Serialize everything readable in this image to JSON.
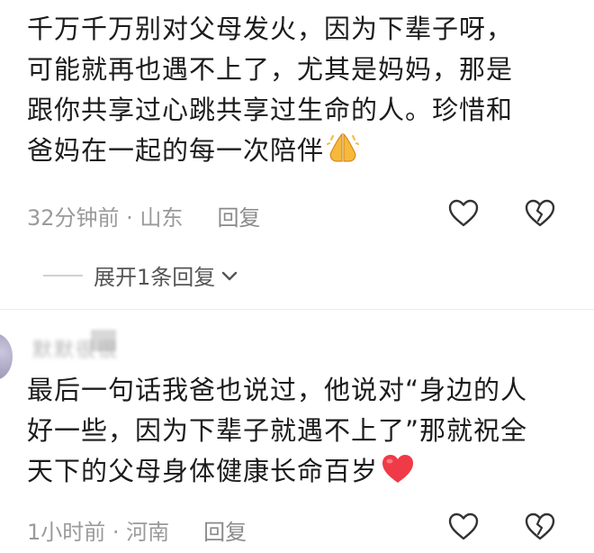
{
  "comment1": {
    "lines": [
      "千万千万别对父母发火，因为下辈子呀，",
      "可能就再也遇不上了，尤其是妈妈，那是",
      "跟你共享过心跳共享过生命的人。珍惜和",
      "爸妈在一起的每一次陪伴"
    ],
    "emoji": "praying-hands-emoji",
    "time_location": "32分钟前 · 山东",
    "reply_label": "回复"
  },
  "expand_replies": {
    "label": "展开1条回复"
  },
  "comment2": {
    "username": "默默很很",
    "lines": [
      "最后一句话我爸也说过，他说对“身边的人",
      "好一些，因为下辈子就遇不上了”那就祝全",
      "天下的父母身体健康长命百岁"
    ],
    "emoji": "red-heart-emoji",
    "time_location": "1小时前 · 河南",
    "reply_label": "回复"
  },
  "colors": {
    "text": "#1c1c1c",
    "meta": "#9a9a9a",
    "heart_emoji": "#f03a47",
    "praying_emoji": "#f6b93b"
  }
}
